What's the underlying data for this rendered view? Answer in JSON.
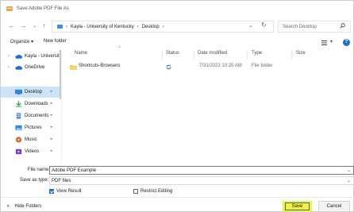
{
  "window": {
    "title": "Save Adobe PDF File As"
  },
  "address": {
    "crumbs": [
      "Kayla - University of Kentucky",
      "Desktop"
    ],
    "search_placeholder": "Search Desktop"
  },
  "toolbar": {
    "organize": "Organize ▾",
    "new_folder": "New folder"
  },
  "nav": {
    "items": [
      {
        "label": "Kayla - Universit",
        "icon": "cloud-icon"
      },
      {
        "label": "OneDrive",
        "icon": "cloud-icon"
      },
      {
        "label": "Desktop",
        "icon": "desktop-icon",
        "selected": true
      },
      {
        "label": "Downloads",
        "icon": "download-icon"
      },
      {
        "label": "Documents",
        "icon": "document-icon"
      },
      {
        "label": "Pictures",
        "icon": "pictures-icon"
      },
      {
        "label": "Music",
        "icon": "music-icon"
      },
      {
        "label": "Videos",
        "icon": "videos-icon"
      }
    ]
  },
  "list": {
    "columns": [
      "Name",
      "Status",
      "Date modified",
      "Type",
      "Size"
    ],
    "rows": [
      {
        "name": "Shortcuts-Browsers",
        "status": "sync-icon",
        "date": "7/31/2023 10:20 AM",
        "type": "File folder",
        "size": ""
      }
    ]
  },
  "form": {
    "filename_label": "File name:",
    "filename_value": "Adobe PDF Example",
    "savetype_label": "Save as type:",
    "savetype_value": "PDF files",
    "view_result": "View Result",
    "view_result_checked": true,
    "restrict_editing": "Restrict Editing",
    "restrict_editing_checked": false
  },
  "footer": {
    "hide_folders": "Hide Folders",
    "save": "Save",
    "cancel": "Cancel"
  },
  "colors": {
    "accent": "#1a6fd1",
    "highlight": "#f6f038",
    "selection": "#cce4f7"
  }
}
